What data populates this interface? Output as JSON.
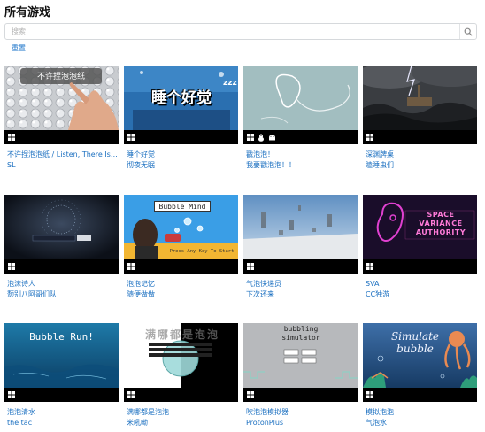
{
  "page": {
    "title": "所有游戏"
  },
  "search": {
    "placeholder": "搜索",
    "reset_label": "重置"
  },
  "colors": {
    "link": "#1a6fc0",
    "platform_bar": "#000000"
  },
  "games": [
    {
      "title": "不许捏泡泡纸 / Listen, There Is No...",
      "author": "SL",
      "thumb_text": "不许捏泡泡纸",
      "platforms": [
        "windows-icon"
      ]
    },
    {
      "title": "睡个好觉",
      "author": "彻夜无眠",
      "thumb_text": "睡个好觉",
      "platforms": [
        "windows-icon"
      ]
    },
    {
      "title": "戳泡泡！",
      "author": "我要戳泡泡！！",
      "thumb_text": "",
      "platforms": [
        "windows-icon",
        "linux-icon",
        "android-icon"
      ]
    },
    {
      "title": "深渊牌桌",
      "author": "瞌睡虫们",
      "thumb_text": "",
      "platforms": [
        "windows-icon"
      ]
    },
    {
      "title": "泡沫诗人",
      "author": "颓别八阿哥们队",
      "thumb_text": "",
      "platforms": [
        "windows-icon"
      ]
    },
    {
      "title": "泡泡记忆",
      "author": "随便做做",
      "thumb_text": "Bubble Mind",
      "thumb_subtext": "Press Any Key To Start",
      "platforms": [
        "windows-icon"
      ]
    },
    {
      "title": "气泡快递员",
      "author": "下次还来",
      "thumb_text": "",
      "platforms": [
        "windows-icon"
      ]
    },
    {
      "title": "SVA",
      "author": "CC独游",
      "thumb_text": "SPACE VARIANCE AUTHORITY",
      "platforms": [
        "windows-icon"
      ]
    },
    {
      "title": "泡泡清水",
      "author": "the tac",
      "thumb_text": "Bubble Run!",
      "platforms": [
        "windows-icon"
      ]
    },
    {
      "title": "满哪都是泡泡",
      "author": "米吼呦",
      "thumb_text": "满哪都是泡泡",
      "platforms": [
        "windows-icon"
      ]
    },
    {
      "title": "吹泡泡模拟器",
      "author": "ProtonPlus",
      "thumb_text": "bubbling simulator",
      "platforms": [
        "windows-icon"
      ]
    },
    {
      "title": "模拟泡泡",
      "author": "气泡水",
      "thumb_text": "Simulate bubble",
      "platforms": [
        "windows-icon"
      ]
    }
  ]
}
